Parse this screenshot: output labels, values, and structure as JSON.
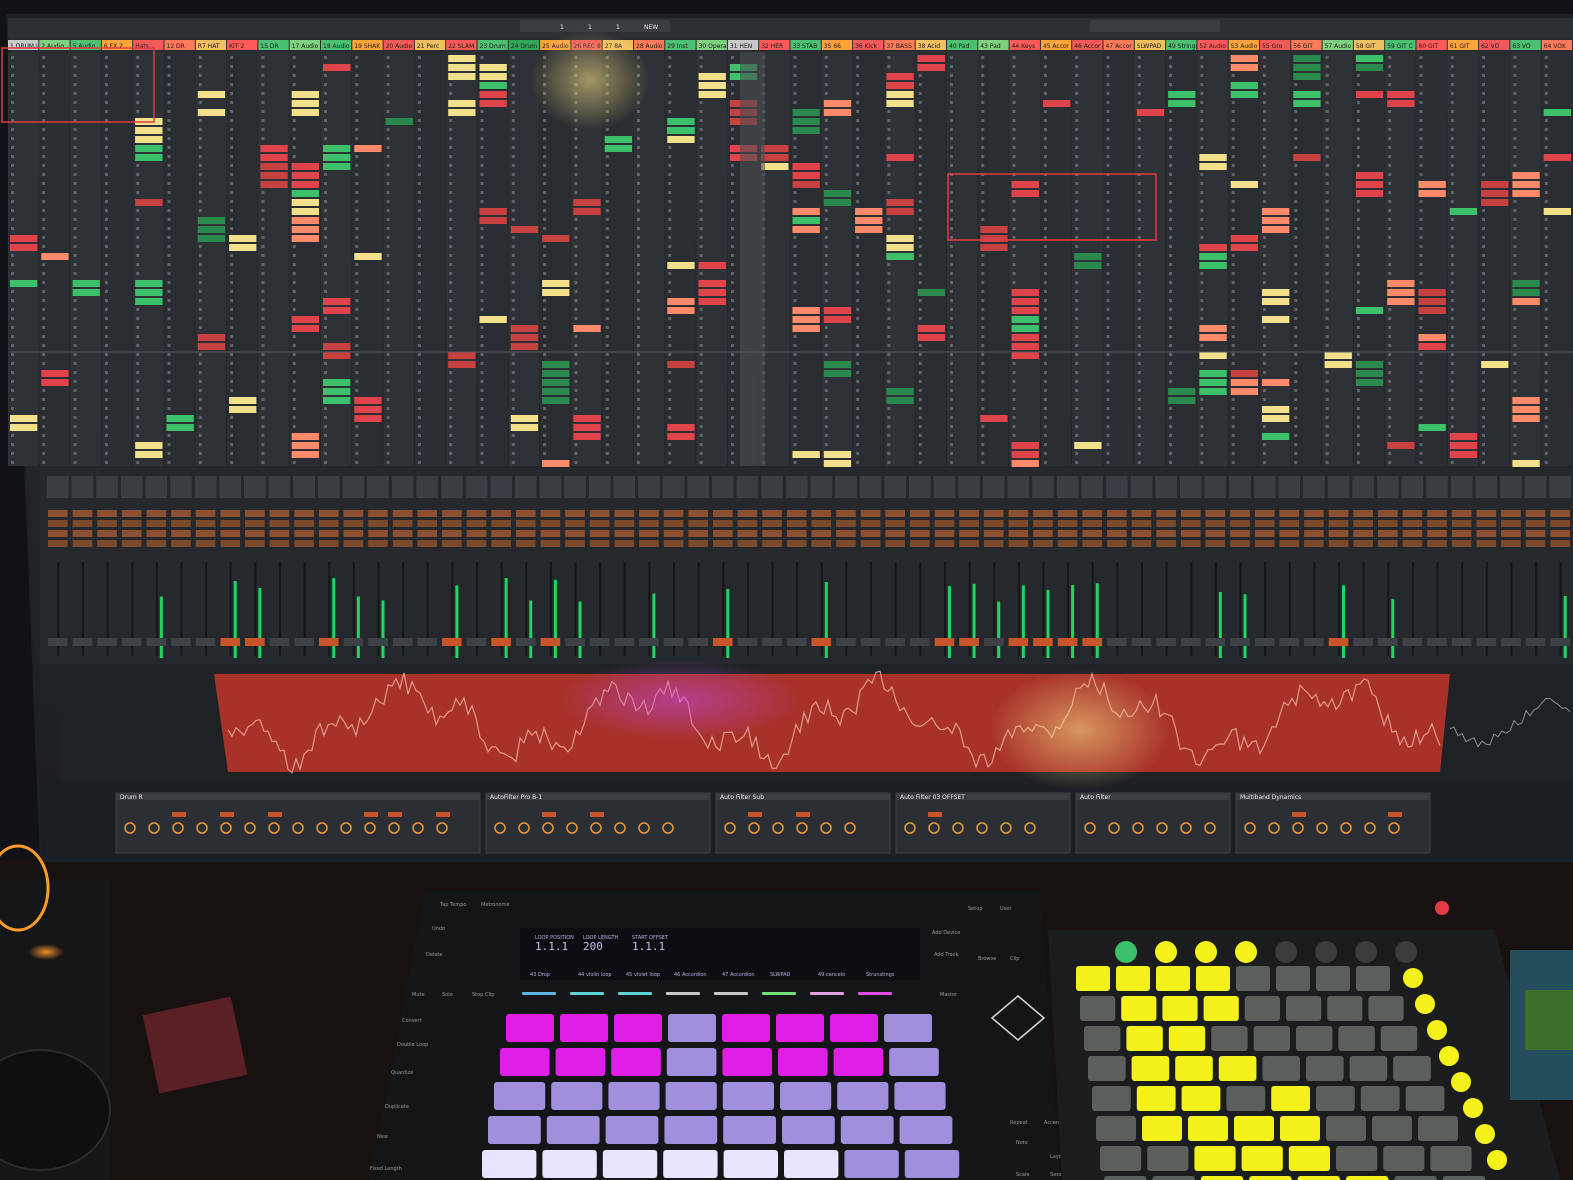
{
  "daw": {
    "topbar_readouts": [
      "1",
      "1",
      "1",
      "NEW"
    ],
    "track_headers": [
      {
        "label": "1 DRUM L",
        "color": "#c9c9c9"
      },
      {
        "label": "2 Audio",
        "color": "#7fd17f"
      },
      {
        "label": "5 Audio",
        "color": "#4cc072"
      },
      {
        "label": "6 FX 2",
        "color": "#ffa43a"
      },
      {
        "label": "Hats",
        "color": "#f25a5a"
      },
      {
        "label": "12 DR",
        "color": "#ff7a5a"
      },
      {
        "label": "R7 HAT",
        "color": "#f0c060"
      },
      {
        "label": "KIT 2",
        "color": "#ff5a5a"
      },
      {
        "label": "15 DR",
        "color": "#4cc072"
      },
      {
        "label": "17 Audio",
        "color": "#7fd17f"
      },
      {
        "label": "18 Audio",
        "color": "#4cc072"
      },
      {
        "label": "19 SHAK",
        "color": "#ffa43a"
      },
      {
        "label": "20 Audio",
        "color": "#f25a5a"
      },
      {
        "label": "21 Perc",
        "color": "#f0c060"
      },
      {
        "label": "22 SLAM",
        "color": "#ff5a5a"
      },
      {
        "label": "23 Drum",
        "color": "#4cc072"
      },
      {
        "label": "24 Drum",
        "color": "#2fa85a"
      },
      {
        "label": "25 Audio",
        "color": "#ffa43a"
      },
      {
        "label": "26 REC 8",
        "color": "#f25a5a"
      },
      {
        "label": "27 8A",
        "color": "#f0c060"
      },
      {
        "label": "28 Audio",
        "color": "#ff7a5a"
      },
      {
        "label": "29 Inst",
        "color": "#4cc072"
      },
      {
        "label": "30 Opera",
        "color": "#7fd17f"
      },
      {
        "label": "31 HEN",
        "color": "#c9c9c9"
      },
      {
        "label": "32 HER",
        "color": "#ff5a5a"
      },
      {
        "label": "33 STAB",
        "color": "#4cc072"
      },
      {
        "label": "35 66",
        "color": "#ffa43a"
      },
      {
        "label": "36 Kick",
        "color": "#f25a5a"
      },
      {
        "label": "37 BASS",
        "color": "#ff7a5a"
      },
      {
        "label": "38 Acid",
        "color": "#f0c060"
      },
      {
        "label": "40 Pad",
        "color": "#4cc072"
      },
      {
        "label": "43 Pad",
        "color": "#7fd17f"
      },
      {
        "label": "44 Keys",
        "color": "#ff5a5a"
      },
      {
        "label": "45 Accor",
        "color": "#ffa43a"
      },
      {
        "label": "46 Accor",
        "color": "#f25a5a"
      },
      {
        "label": "47 Accor",
        "color": "#ff7a5a"
      },
      {
        "label": "SLWPAD",
        "color": "#f0c060"
      },
      {
        "label": "49 Strings",
        "color": "#4cc072"
      },
      {
        "label": "52 Audio",
        "color": "#ff5a5a"
      },
      {
        "label": "53 Audio",
        "color": "#ffa43a"
      },
      {
        "label": "55 Gro",
        "color": "#f25a5a"
      },
      {
        "label": "56 GIT",
        "color": "#ff7a5a"
      },
      {
        "label": "57 Audio",
        "color": "#7fd17f"
      },
      {
        "label": "58 GIT",
        "color": "#f0c060"
      },
      {
        "label": "59 GIT C",
        "color": "#4cc072"
      },
      {
        "label": "60 GIT",
        "color": "#ff5a5a"
      },
      {
        "label": "61 GIT",
        "color": "#ffa43a"
      },
      {
        "label": "62 VO",
        "color": "#f25a5a"
      },
      {
        "label": "63 VO",
        "color": "#4cc072"
      },
      {
        "label": "64 VOX",
        "color": "#ff7a5a"
      }
    ],
    "device_titles": [
      "Drum R",
      "AutoFilter Pro B-1",
      "Auto Filter Sub",
      "Auto Filter 03 OFFSET",
      "Auto Filter",
      "Multiband Dynamics"
    ]
  },
  "push": {
    "left_buttons": [
      "Tap Tempo",
      "Metronome",
      "Undo",
      "Delete",
      "Mute",
      "Solo",
      "Stop Clip",
      "Convert",
      "Double Loop",
      "Quantize",
      "Duplicate",
      "New",
      "Fixed Length"
    ],
    "right_buttons": [
      "Setup",
      "User",
      "Add Device",
      "Add Track",
      "Browse",
      "Clip",
      "Master",
      "Repeat",
      "Accent",
      "Scale",
      "Layout",
      "Note",
      "Session"
    ],
    "display": {
      "loop_position_label": "LOOP POSITION",
      "loop_position_value": "1.1.1",
      "loop_length_label": "LOOP LENGTH",
      "loop_length_value": "200",
      "start_offset_label": "START OFFSET",
      "start_offset_value": "1.1.1",
      "tracks": [
        "43 Drop",
        "44 violin loop",
        "45 violet loop",
        "46 Accordion",
        "47 Accordion",
        "SLWPAD",
        "49 cancelo",
        "Strunstings"
      ]
    }
  },
  "colors": {
    "pad_magenta": "#e01fe6",
    "pad_lavender": "#9f8fdc",
    "pad_white": "#e9e4ff",
    "pad_yellow": "#f4f21a",
    "pad_off": "#5a5f5c",
    "meter_green": "#1ed760",
    "clip_red": "#e0444a",
    "clip_green": "#3cc06a",
    "clip_yellow": "#f2e08a",
    "waveform_bg": "#a8322a"
  }
}
